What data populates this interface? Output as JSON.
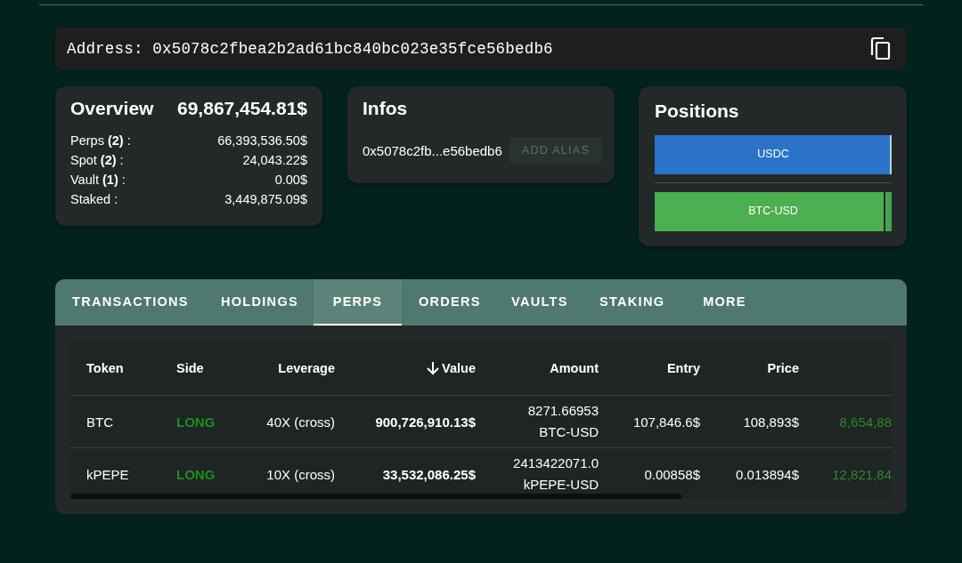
{
  "address": {
    "label": "Address:",
    "value": "0x5078c2fbea2b2ad61bc840bc023e35fce56bedb6"
  },
  "overview": {
    "title": "Overview",
    "total": "69,867,454.81$",
    "rows": [
      {
        "label": "Perps **(2)** :",
        "value": "66,393,536.50$"
      },
      {
        "label": "Spot **(2)** :",
        "value": "24,043.22$"
      },
      {
        "label": "Vault **(1)** :",
        "value": "0.00$"
      },
      {
        "label": "Staked :",
        "value": "3,449,875.09$"
      }
    ]
  },
  "infos": {
    "title": "Infos",
    "address_short": "0x5078c2fb...e56bedb6",
    "alias_button": {
      "label": "ADD ALIAS",
      "disabled": true
    }
  },
  "positions": {
    "title": "Positions",
    "bars": [
      {
        "label": "USDC",
        "color": "#2a73c9",
        "level": 0.995
      },
      {
        "label": "BTC-USD",
        "color": "#4caf50",
        "level": 0.965
      }
    ]
  },
  "tabs": [
    {
      "label": "TRANSACTIONS",
      "selected": false
    },
    {
      "label": "HOLDINGS",
      "selected": false
    },
    {
      "label": "PERPS",
      "selected": true
    },
    {
      "label": "ORDERS",
      "selected": false
    },
    {
      "label": "VAULTS",
      "selected": false
    },
    {
      "label": "STAKING",
      "selected": false
    },
    {
      "label": "MORE",
      "selected": false
    }
  ],
  "table": {
    "columns": [
      {
        "label": "Token"
      },
      {
        "label": "Side"
      },
      {
        "label": "Leverage"
      },
      {
        "label": "Value",
        "sorted": true
      },
      {
        "label": "Amount"
      },
      {
        "label": "Entry"
      },
      {
        "label": "Price"
      }
    ],
    "rows": [
      {
        "token": "BTC",
        "side": "LONG",
        "leverage": "40X (cross)",
        "value": "900,726,910.13$",
        "amount": "8271.66953",
        "amount_unit": "BTC-USD",
        "entry": "107,846.6$",
        "price": "108,893$",
        "column_8": "8,654,88"
      },
      {
        "token": "kPEPE",
        "side": "LONG",
        "leverage": "10X (cross)",
        "value": "33,532,086.25$",
        "amount": "2413422071.0",
        "amount_unit": "kPEPE-USD",
        "entry": "0.00858$",
        "price": "0.013894$",
        "column_8": "12,821,84"
      }
    ]
  }
}
